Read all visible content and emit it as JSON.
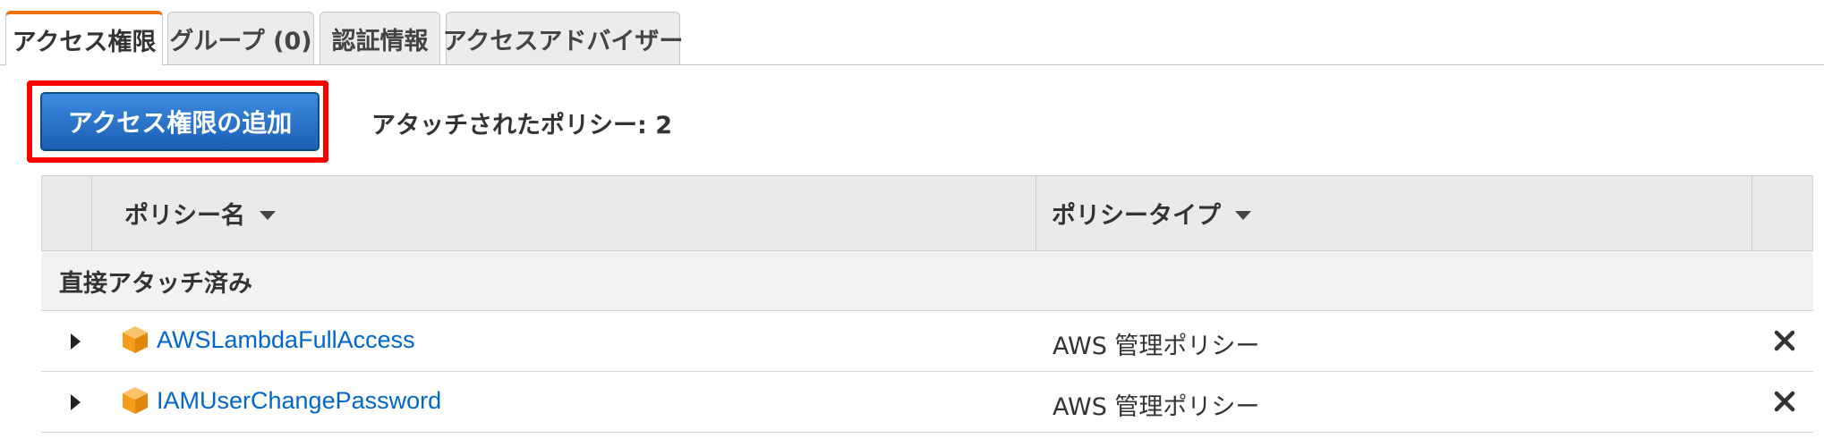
{
  "tabs": [
    {
      "label": "アクセス権限",
      "active": true
    },
    {
      "label": "グループ (0)",
      "active": false
    },
    {
      "label": "認証情報",
      "active": false
    },
    {
      "label": "アクセスアドバイザー",
      "active": false
    }
  ],
  "actions": {
    "add_permissions_label": "アクセス権限の追加",
    "attached_policies_text": "アタッチされたポリシー: 2"
  },
  "table": {
    "columns": [
      {
        "label": "ポリシー名",
        "sortable": true
      },
      {
        "label": "ポリシータイプ",
        "sortable": true
      }
    ],
    "group_label": "直接アタッチ済み",
    "rows": [
      {
        "name": "AWSLambdaFullAccess",
        "type": "AWS 管理ポリシー",
        "icon": "aws-cube-icon"
      },
      {
        "name": "IAMUserChangePassword",
        "type": "AWS 管理ポリシー",
        "icon": "aws-cube-icon"
      }
    ]
  },
  "colors": {
    "active_tab_accent": "#ec7211",
    "primary_button": "#1f6fd0",
    "highlight": "#ff0000",
    "link": "#0066cc",
    "aws_icon": "#f7a51b"
  },
  "icons": {
    "sort": "caret-down-icon",
    "expand": "caret-right-icon",
    "remove": "close-x-icon",
    "policy": "aws-cube-icon"
  }
}
